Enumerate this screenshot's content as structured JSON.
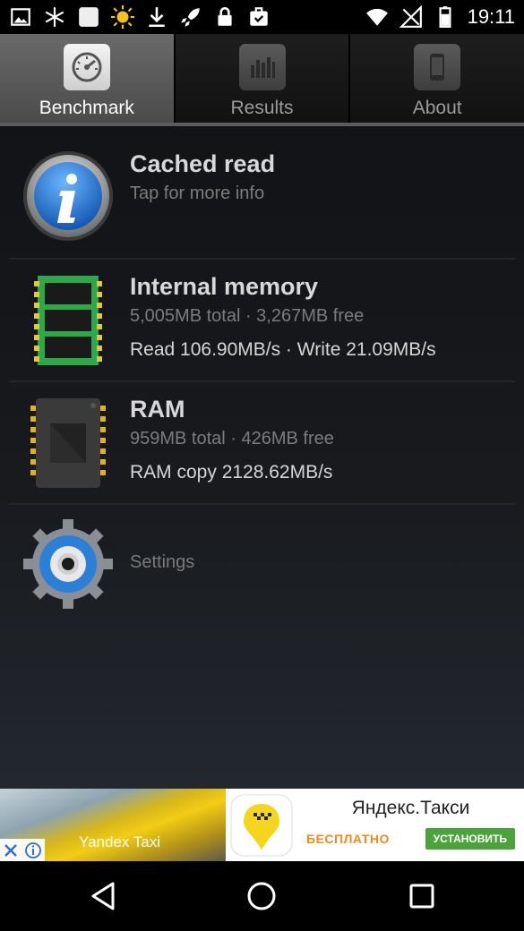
{
  "status_bar": {
    "time": "19:11",
    "left_icons": [
      "image-icon",
      "snowflake-icon",
      "square-icon",
      "sun-icon",
      "download-icon",
      "rocket-icon",
      "lock-icon",
      "briefcase-check-icon"
    ],
    "right_icons": [
      "wifi-icon",
      "no-signal-icon",
      "battery-icon"
    ]
  },
  "tabs": [
    {
      "label": "Benchmark",
      "icon": "speedometer-icon",
      "active": true
    },
    {
      "label": "Results",
      "icon": "bar-chart-icon",
      "active": false
    },
    {
      "label": "About",
      "icon": "phone-icon",
      "active": false
    }
  ],
  "items": {
    "cached": {
      "title": "Cached read",
      "subtitle": "Tap for more info",
      "icon": "info-icon"
    },
    "internal": {
      "title": "Internal memory",
      "subtitle": "5,005MB total · 3,267MB free",
      "line": "Read 106.90MB/s · Write 21.09MB/s",
      "icon": "memory-card-icon"
    },
    "ram": {
      "title": "RAM",
      "subtitle": "959MB total · 426MB free",
      "line": "RAM copy 2128.62MB/s",
      "icon": "chip-icon"
    },
    "settings": {
      "label": "Settings",
      "icon": "gear-icon"
    }
  },
  "ad": {
    "photo_text": "Yandex Taxi",
    "title": "Яндекс.Такси",
    "free_label": "БЕСПЛАТНО",
    "install_label": "УСТАНОВИТЬ"
  },
  "colors": {
    "accent_blue": "#2c7fd6",
    "chip_gold": "#e0b21c",
    "ad_green": "#4ca33c",
    "ad_orange": "#f08a1a"
  }
}
